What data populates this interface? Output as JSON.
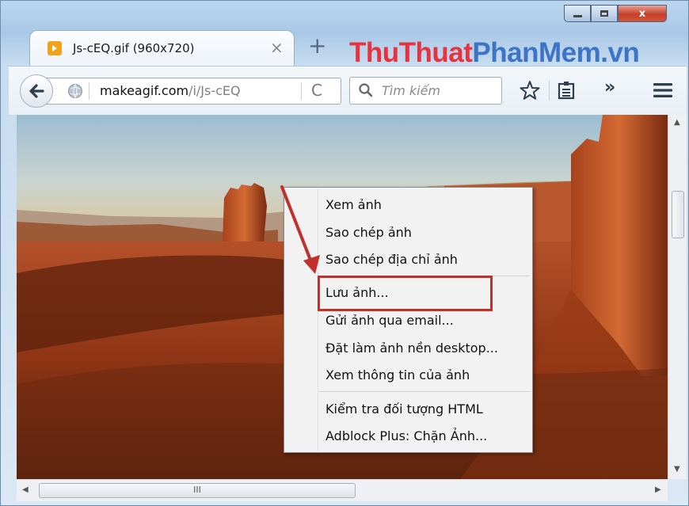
{
  "window": {
    "brand_part1": "ThuThuat",
    "brand_part2": "PhanMem.vn",
    "min_glyph": "–",
    "max_glyph": "□",
    "close_glyph": "x"
  },
  "tab": {
    "title": "Js-cEQ.gif (960x720)",
    "close_glyph": "×",
    "new_tab_glyph": "+"
  },
  "navbar": {
    "url_domain": "makeagif.com",
    "url_path": "/i/Js-cEQ",
    "reload_glyph": "C",
    "search_placeholder": "Tìm kiếm",
    "overflow_glyph": "»"
  },
  "scrollbar": {
    "grip": "III"
  },
  "context_menu": {
    "items": [
      "Xem ảnh",
      "Sao chép ảnh",
      "Sao chép địa chỉ ảnh",
      "Lưu ảnh...",
      "Gửi ảnh qua email...",
      "Đặt làm ảnh nền desktop...",
      "Xem thông tin của ảnh",
      "Kiểm tra đối tượng HTML",
      "Adblock Plus: Chặn Ảnh..."
    ],
    "highlighted_index": 3
  },
  "colors": {
    "highlight_box": "#c0302c",
    "arrow": "#c0302c",
    "brand_red": "#e8333f",
    "brand_blue": "#3e74c5"
  }
}
